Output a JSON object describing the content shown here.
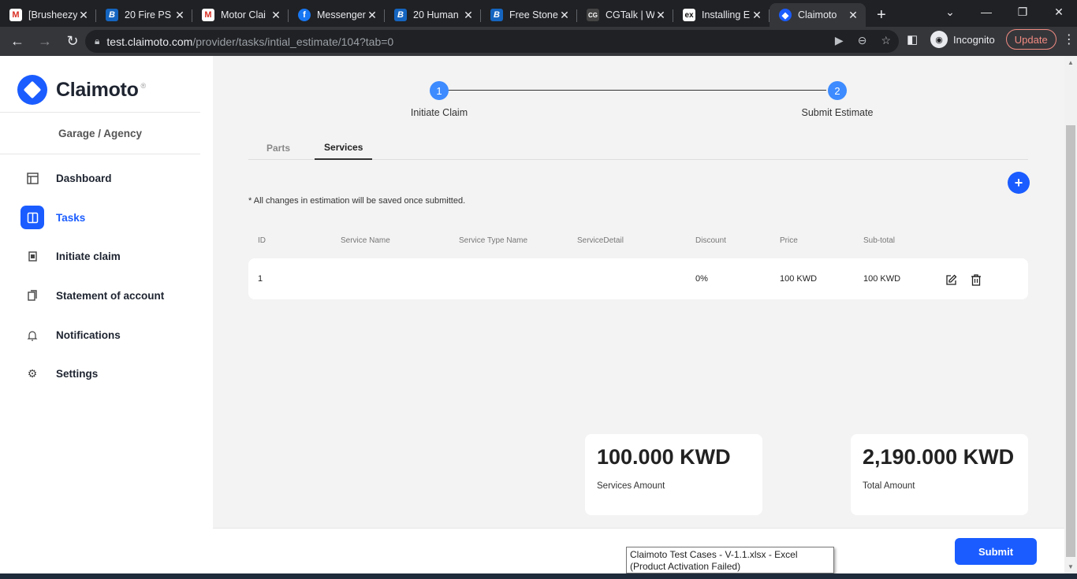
{
  "browser": {
    "tabs": [
      {
        "title": "[Brusheezy",
        "favicon": "gmail-icon",
        "glyph": "M"
      },
      {
        "title": "20 Fire PS",
        "favicon": "b-icon",
        "glyph": "B"
      },
      {
        "title": "Motor Clai",
        "favicon": "gmail-icon",
        "glyph": "M"
      },
      {
        "title": "Messenger",
        "favicon": "facebook-icon",
        "glyph": "f"
      },
      {
        "title": "20 Human",
        "favicon": "b-icon",
        "glyph": "B"
      },
      {
        "title": "Free Stone",
        "favicon": "b-icon",
        "glyph": "B"
      },
      {
        "title": "CGTalk | W",
        "favicon": "cgtalk-icon",
        "glyph": "CG"
      },
      {
        "title": "Installing E",
        "favicon": "ex-icon",
        "glyph": "ex"
      },
      {
        "title": "Claimoto",
        "favicon": "claimoto-icon",
        "glyph": "◆"
      }
    ],
    "url_host": "test.claimoto.com",
    "url_path": "/provider/tasks/intial_estimate/104?tab=0",
    "profile_label": "Incognito",
    "update_label": "Update"
  },
  "sidebar": {
    "brand": "Claimoto",
    "brand_mark": "®",
    "section": "Garage / Agency",
    "items": [
      {
        "label": "Dashboard",
        "icon": "dashboard-icon"
      },
      {
        "label": "Tasks",
        "icon": "tasks-icon"
      },
      {
        "label": "Initiate claim",
        "icon": "claim-icon"
      },
      {
        "label": "Statement of account",
        "icon": "statement-icon"
      },
      {
        "label": "Notifications",
        "icon": "bell-icon"
      },
      {
        "label": "Settings",
        "icon": "gear-icon"
      }
    ]
  },
  "stepper": {
    "steps": [
      {
        "number": "1",
        "label": "Initiate Claim"
      },
      {
        "number": "2",
        "label": "Submit Estimate"
      }
    ]
  },
  "tabs": [
    "Parts",
    "Services"
  ],
  "active_tab": "Services",
  "note": "* All changes in estimation will be saved once submitted.",
  "table": {
    "headers": [
      "ID",
      "Service Name",
      "Service Type Name",
      "ServiceDetail",
      "Discount",
      "Price",
      "Sub-total"
    ],
    "rows": [
      {
        "id": "1",
        "service_name": "",
        "service_type": "",
        "detail": "",
        "discount": "0%",
        "price": "100 KWD",
        "subtotal": "100 KWD"
      }
    ]
  },
  "summary": {
    "services_amount": "100.000 KWD",
    "services_label": "Services Amount",
    "total_amount": "2,190.000 KWD",
    "total_label": "Total Amount"
  },
  "submit_label": "Submit",
  "tooltip": "Claimoto Test Cases - V-1.1.xlsx - Excel (Product Activation Failed)",
  "colors": {
    "accent": "#1a5cff",
    "step": "#3d8bff"
  }
}
